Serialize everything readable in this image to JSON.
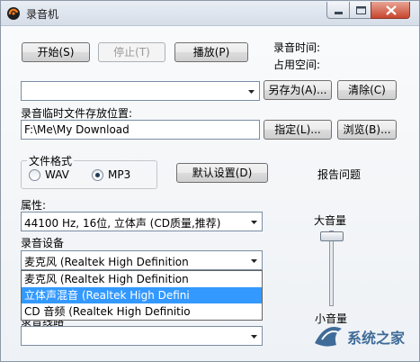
{
  "window": {
    "title": "录音机"
  },
  "toolbar": {
    "start_label": "开始(S)",
    "stop_label": "停止(T)",
    "play_label": "播放(P)"
  },
  "info": {
    "rec_time_label": "录音时间:",
    "space_label": "占用空间:"
  },
  "file": {
    "save_as_label": "另存为(A)...",
    "clear_label": "清除(C)"
  },
  "temp": {
    "label": "录音临时文件存放位置:",
    "path": "F:\\Me\\My Download",
    "assign_label": "指定(L)...",
    "browse_label": "浏览(B)..."
  },
  "format": {
    "group_label": "文件格式",
    "wav_label": "WAV",
    "mp3_label": "MP3",
    "selected": "MP3",
    "default_label": "默认设置(D)"
  },
  "report_label": "报告问题",
  "attributes": {
    "label": "属性:",
    "value": "44100 Hz, 16位, 立体声 (CD质量,推荐)"
  },
  "device": {
    "label": "录音设备",
    "value": "麦克风 (Realtek High Definition",
    "options": [
      "麦克风 (Realtek High Definition",
      "立体声混音 (Realtek High Defini",
      "CD 音频 (Realtek High Definitio"
    ],
    "selected_index": 1
  },
  "line": {
    "label": "录音线路"
  },
  "volume": {
    "max_label": "大音量",
    "min_label": "小音量"
  },
  "colors": {
    "highlight": "#3399ff",
    "close_button": "#c7462e"
  },
  "watermark": {
    "text": "系统之家"
  }
}
